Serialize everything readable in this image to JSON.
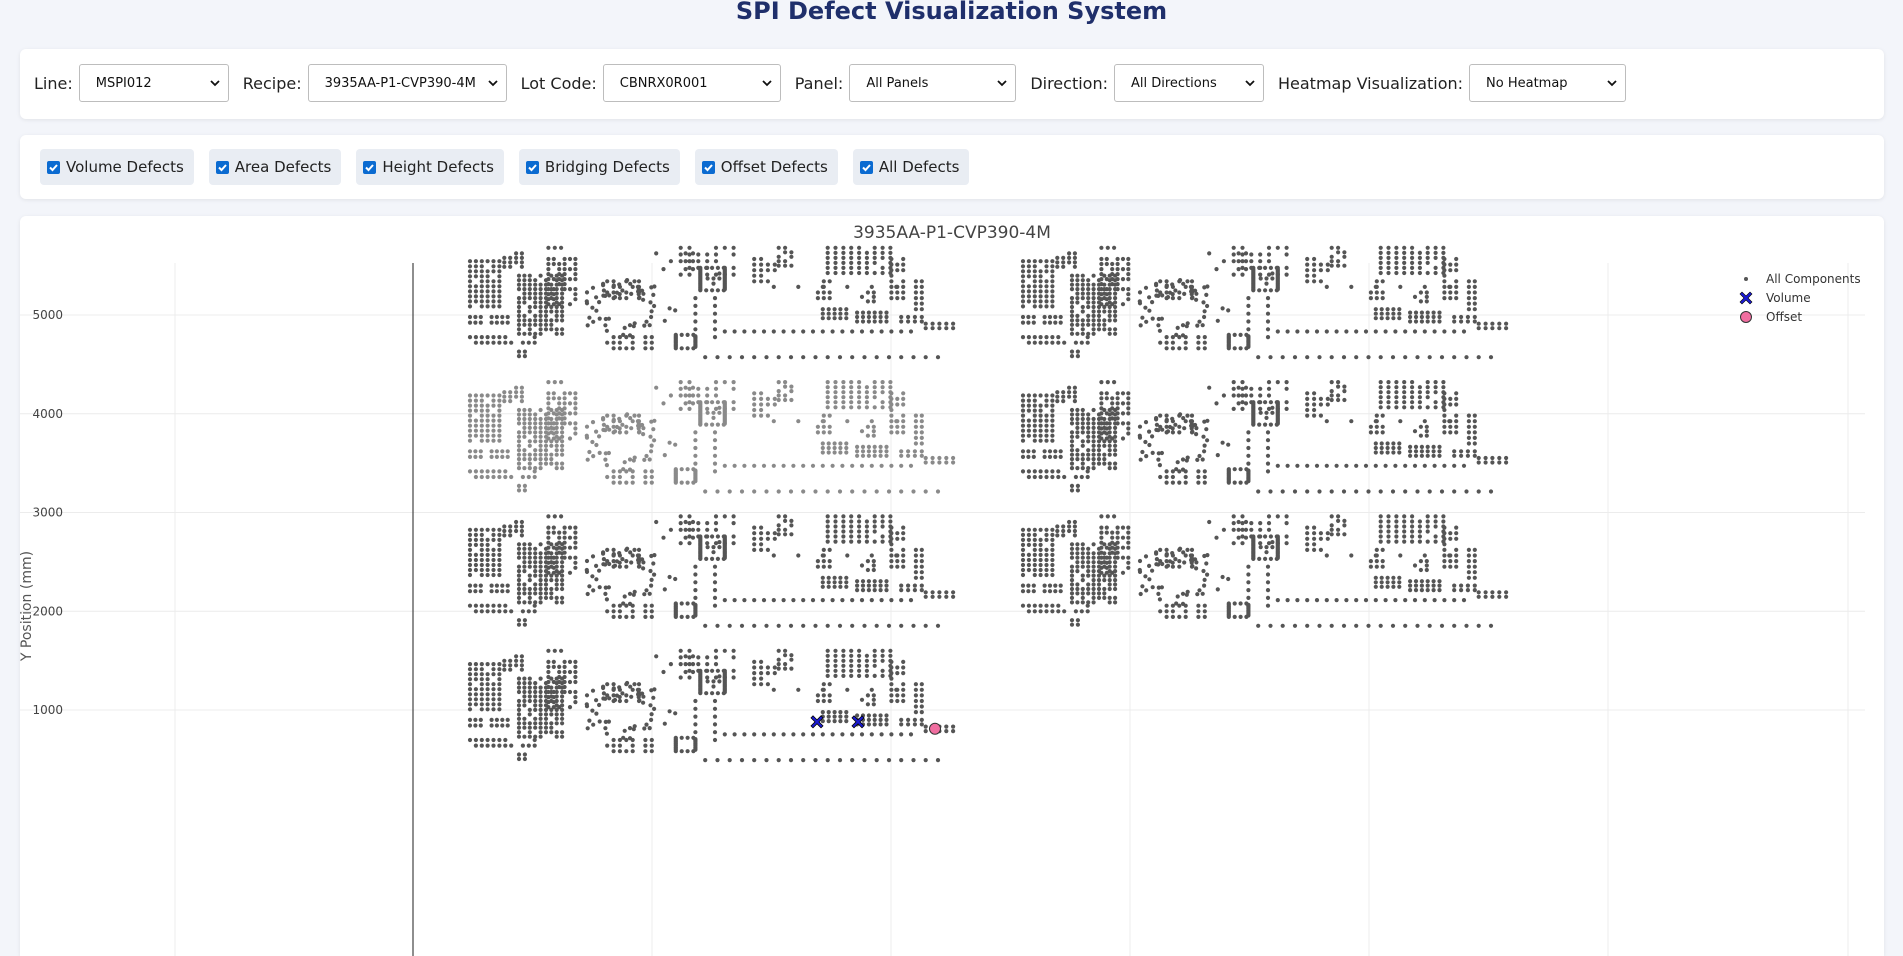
{
  "header": {
    "title": "SPI Defect Visualization System"
  },
  "filters": [
    {
      "key": "line",
      "label": "Line:",
      "value": "MSPI012"
    },
    {
      "key": "recipe",
      "label": "Recipe:",
      "value": "3935AA-P1-CVP390-4M"
    },
    {
      "key": "lot",
      "label": "Lot Code:",
      "value": "CBNRX0R001"
    },
    {
      "key": "panel",
      "label": "Panel:",
      "value": "All Panels"
    },
    {
      "key": "direction",
      "label": "Direction:",
      "value": "All Directions"
    },
    {
      "key": "heatmap",
      "label": "Heatmap Visualization:",
      "value": "No Heatmap"
    }
  ],
  "defect_types": [
    {
      "label": "Volume Defects",
      "checked": true
    },
    {
      "label": "Area Defects",
      "checked": true
    },
    {
      "label": "Height Defects",
      "checked": true
    },
    {
      "label": "Bridging Defects",
      "checked": true
    },
    {
      "label": "Offset Defects",
      "checked": true
    },
    {
      "label": "All Defects",
      "checked": true
    }
  ],
  "colors": {
    "accent": "#0b6bd1",
    "title": "#1f2f6b",
    "components": "#555555",
    "components_faded": "#8a8a8a",
    "volume": "#1b1bd4",
    "offset": "#f06ea0"
  },
  "chart_data": {
    "type": "scatter",
    "title": "3935AA-P1-CVP390-4M",
    "ylabel": "Y Position (mm)",
    "yticks": [
      1000,
      2000,
      3000,
      4000,
      5000
    ],
    "ylim": [
      400,
      6000
    ],
    "grid": true,
    "legend_position": "top-right",
    "legend": [
      {
        "name": "All Components",
        "symbol": "dot",
        "color": "#555555"
      },
      {
        "name": "Volume",
        "symbol": "x",
        "color": "#1b1bd4"
      },
      {
        "name": "Offset",
        "symbol": "circle",
        "color": "#f06ea0"
      }
    ],
    "panels": [
      {
        "column": 1,
        "y_range": [
          4550,
          5680
        ]
      },
      {
        "column": 2,
        "y_range": [
          4550,
          5680
        ]
      },
      {
        "column": 1,
        "y_range": [
          3190,
          4320
        ],
        "highlighted": true
      },
      {
        "column": 2,
        "y_range": [
          3190,
          4320
        ]
      },
      {
        "column": 1,
        "y_range": [
          1830,
          2960
        ]
      },
      {
        "column": 2,
        "y_range": [
          1830,
          2960
        ]
      },
      {
        "column": 1,
        "y_range": [
          470,
          1600
        ]
      }
    ],
    "defects": [
      {
        "series": "Volume",
        "y": 880,
        "panel": 7
      },
      {
        "series": "Volume",
        "y": 880,
        "panel": 7
      },
      {
        "series": "Offset",
        "y": 810,
        "panel": 7
      }
    ]
  }
}
